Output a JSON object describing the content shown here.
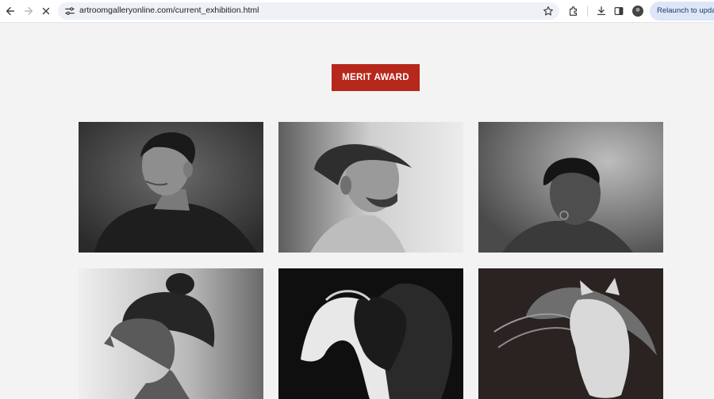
{
  "browser": {
    "url": "artroomgalleryonline.com/current_exhibition.html",
    "relaunch_label": "Relaunch to update",
    "icons": {
      "back": "arrow-left-icon",
      "forward": "arrow-right-icon",
      "reload": "close-icon",
      "site_info": "tune-icon",
      "bookmark": "star-icon",
      "extensions": "puzzle-icon",
      "downloads": "download-icon",
      "side_panel": "side-panel-icon",
      "profile": "avatar"
    }
  },
  "page": {
    "award_label": "MERIT AWARD",
    "accent_color": "#b5281b",
    "background_color": "#f3f3f3",
    "artworks": [
      {
        "subject": "charcoal portrait of a man looking left"
      },
      {
        "subject": "charcoal portrait of a bearded man in profile"
      },
      {
        "subject": "charcoal portrait of a woman with earring"
      },
      {
        "subject": "charcoal portrait of a woman in profile with braided bun"
      },
      {
        "subject": "drawing of a white horse and a black horse"
      },
      {
        "subject": "drawing of a white horse with flowing mane on dark background"
      }
    ]
  }
}
